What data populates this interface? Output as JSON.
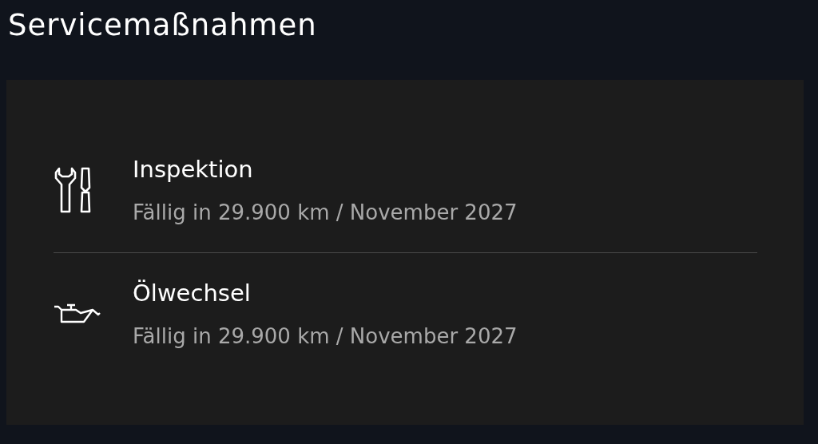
{
  "title": "Servicemaßnahmen",
  "services": [
    {
      "kind": "tools",
      "name": "Inspektion",
      "due": "Fällig in 29.900 km / November 2027"
    },
    {
      "kind": "oil",
      "name": "Ölwechsel",
      "due": "Fällig in 29.900 km / November 2027"
    }
  ]
}
